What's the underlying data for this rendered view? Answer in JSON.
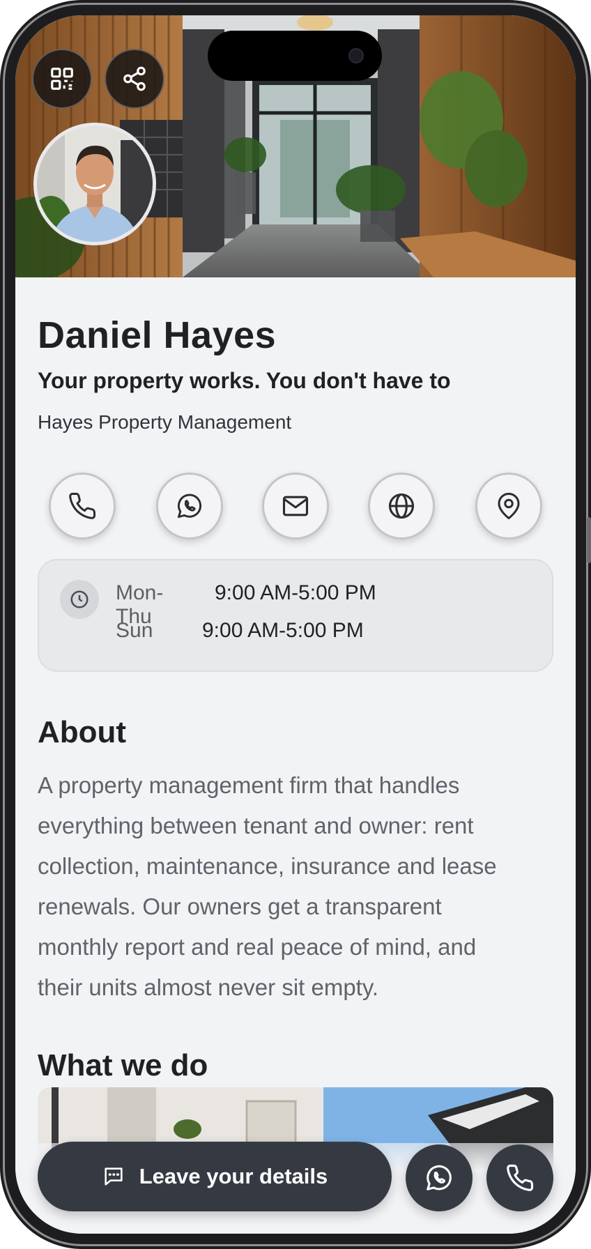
{
  "profile": {
    "name": "Daniel Hayes",
    "tagline": "Your property works. You don't have to",
    "company": "Hayes Property Management"
  },
  "hours": [
    {
      "day": "Mon-Thu",
      "time": "9:00 AM-5:00 PM"
    },
    {
      "day": "Sun",
      "time": "9:00 AM-5:00 PM"
    }
  ],
  "about": {
    "heading": "About",
    "lines": [
      "A property management firm that handles",
      "everything between tenant and owner: rent",
      "collection, maintenance, insurance and lease",
      "renewals. Our owners get a transparent",
      "monthly report and real peace of mind, and",
      "their units almost never sit empty."
    ]
  },
  "services": {
    "heading": "What we do"
  },
  "cta": {
    "label": "Leave your details"
  },
  "icons": {
    "hero": [
      "qr-code-icon",
      "share-icon"
    ],
    "actions": [
      "phone-icon",
      "whatsapp-icon",
      "mail-icon",
      "globe-icon",
      "map-pin-icon"
    ],
    "hours": "clock-icon",
    "cta": "chat-icon",
    "bottom": [
      "whatsapp-icon",
      "phone-icon"
    ]
  },
  "colors": {
    "dark_button": "#353a42",
    "background": "#f2f3f5",
    "text": "#1f2125"
  }
}
